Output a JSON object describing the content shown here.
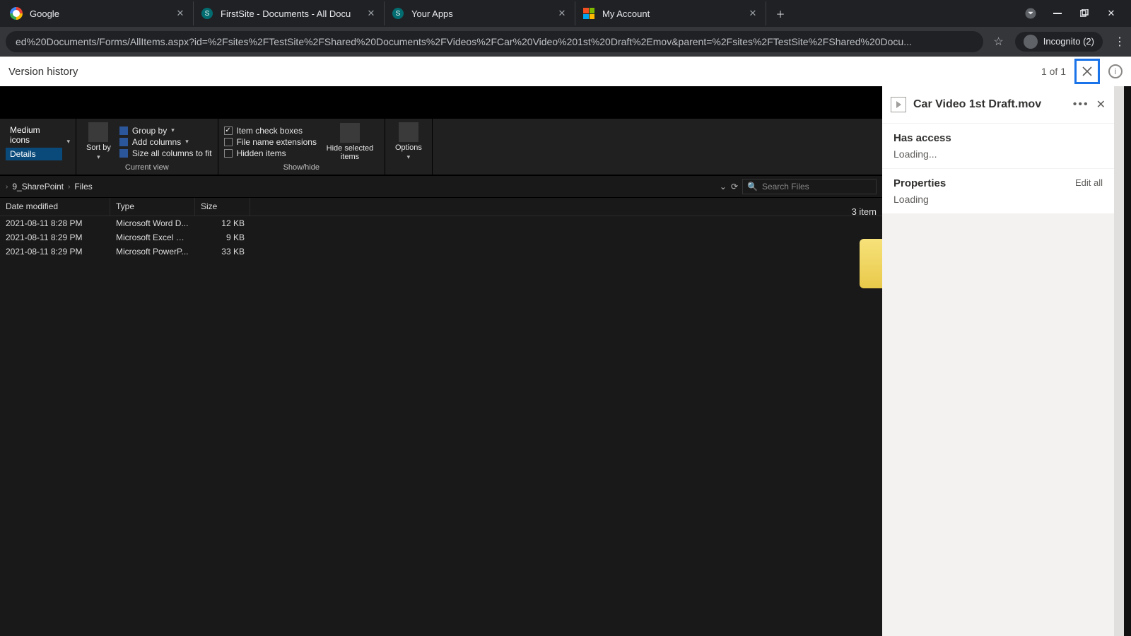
{
  "browser": {
    "tabs": [
      {
        "title": "Google"
      },
      {
        "title": "FirstSite - Documents - All Docu"
      },
      {
        "title": "Your Apps"
      },
      {
        "title": "My Account"
      }
    ],
    "url": "ed%20Documents/Forms/AllItems.aspx?id=%2Fsites%2FTestSite%2FShared%20Documents%2FVideos%2FCar%20Video%201st%20Draft%2Emov&parent=%2Fsites%2FTestSite%2FShared%20Docu...",
    "incognito_label": "Incognito (2)"
  },
  "sp_bar": {
    "title": "Version history",
    "counter": "1 of 1"
  },
  "explorer": {
    "view_options": {
      "medium": "Medium icons",
      "details": "Details"
    },
    "sort_label": "Sort by",
    "groupby": "Group by",
    "addcols": "Add columns",
    "sizecols": "Size all columns to fit",
    "currentview_caption": "Current view",
    "chk_item": "Item check boxes",
    "chk_ext": "File name extensions",
    "chk_hidden": "Hidden items",
    "hide_sel": "Hide selected items",
    "options": "Options",
    "showhide_caption": "Show/hide",
    "crumbs": [
      "9_SharePoint",
      "Files"
    ],
    "search_placeholder": "Search Files",
    "columns": {
      "date": "Date modified",
      "type": "Type",
      "size": "Size"
    },
    "rows": [
      {
        "date": "2021-08-11 8:28 PM",
        "type": "Microsoft Word D...",
        "size": "12 KB"
      },
      {
        "date": "2021-08-11 8:29 PM",
        "type": "Microsoft Excel W...",
        "size": "9 KB"
      },
      {
        "date": "2021-08-11 8:29 PM",
        "type": "Microsoft PowerP...",
        "size": "33 KB"
      }
    ],
    "status": "3 item"
  },
  "details": {
    "filename": "Car Video 1st Draft.mov",
    "access_heading": "Has access",
    "access_status": "Loading...",
    "props_heading": "Properties",
    "props_status": "Loading",
    "edit_all": "Edit all"
  }
}
